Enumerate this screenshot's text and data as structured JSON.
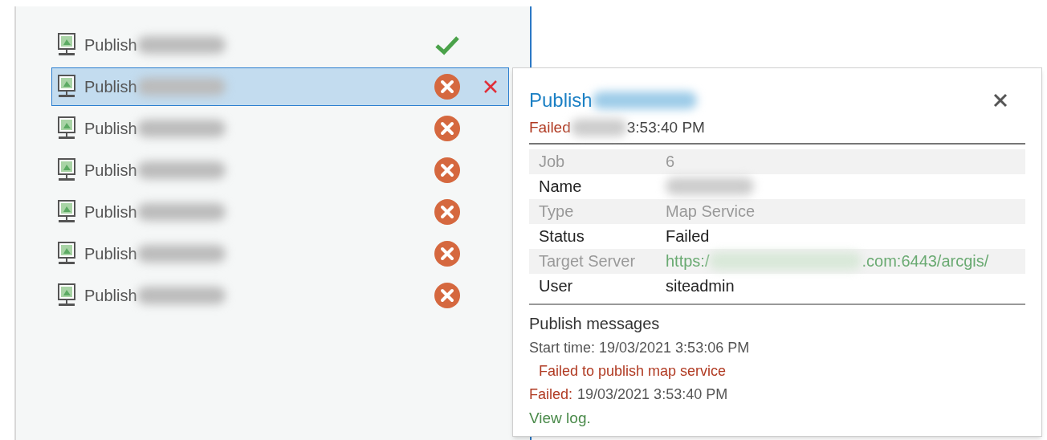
{
  "jobs": [
    {
      "label": "Publish",
      "kind": "success",
      "selected": false
    },
    {
      "label": "Publish",
      "kind": "failed",
      "selected": true
    },
    {
      "label": "Publish",
      "kind": "failed",
      "selected": false
    },
    {
      "label": "Publish",
      "kind": "failed",
      "selected": false
    },
    {
      "label": "Publish",
      "kind": "failed",
      "selected": false
    },
    {
      "label": "Publish",
      "kind": "failed",
      "selected": false
    },
    {
      "label": "Publish",
      "kind": "failed",
      "selected": false
    }
  ],
  "details": {
    "title": "Publish",
    "status": "Failed",
    "time": "3:53:40 PM",
    "fields": [
      {
        "label": "Job",
        "value": "6"
      },
      {
        "label": "Name"
      },
      {
        "label": "Type",
        "value": "Map Service"
      },
      {
        "label": "Status",
        "value": "Failed"
      },
      {
        "label": "Target Server",
        "value": "https:/",
        "value_end": ".com:6443/arcgis/",
        "kind": "link"
      },
      {
        "label": "User",
        "value": "siteadmin"
      }
    ],
    "messages_title": "Publish messages",
    "start_time": "Start time: 19/03/2021 3:53:06 PM",
    "error": "Failed to publish map service",
    "failed_label": "Failed:",
    "failed_time": "19/03/2021 3:53:40 PM",
    "view_log": "View log."
  }
}
